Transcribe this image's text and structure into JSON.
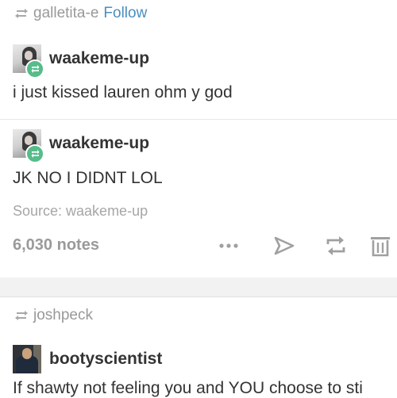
{
  "post1": {
    "reblogged_from": "galletita-e",
    "follow_label": "Follow",
    "entries": [
      {
        "username": "waakeme-up",
        "text": "i just kissed lauren ohm y god"
      },
      {
        "username": "waakeme-up",
        "text": "JK NO I DIDNT LOL"
      }
    ],
    "source": "Source: waakeme-up",
    "notes": "6,030 notes",
    "icons": [
      "more-icon",
      "share-icon",
      "reblog-icon",
      "delete-icon"
    ]
  },
  "post2": {
    "reblogged_from": "joshpeck",
    "entries": [
      {
        "username": "bootyscientist",
        "text": "If shawty not feeling you and YOU choose to sti"
      }
    ]
  },
  "colors": {
    "link_blue": "#4a8fbf",
    "reblog_green": "#56bc8a",
    "muted_gray": "#999999",
    "icon_gray": "#a0a0a0"
  }
}
